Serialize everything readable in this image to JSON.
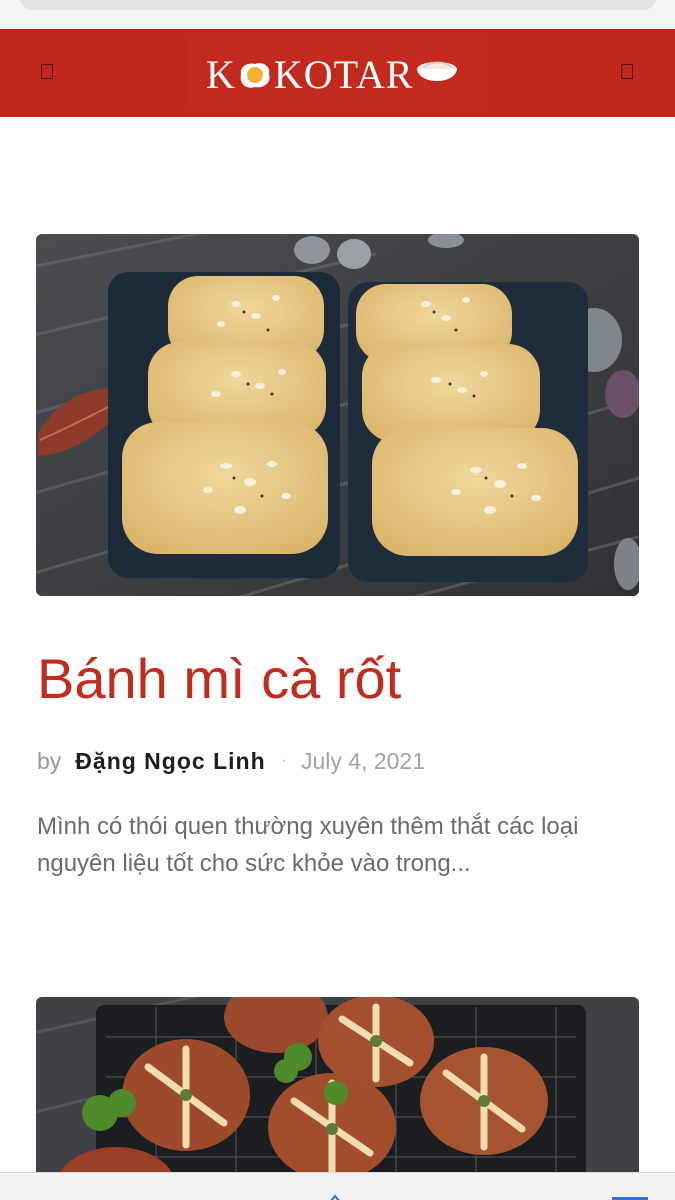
{
  "header": {
    "logo_text_left": "K",
    "logo_text_right": "KOTAR",
    "brand_color": "#c0281c",
    "menu_icon": "menu-icon",
    "search_icon": "search-icon"
  },
  "posts": [
    {
      "image": "oat-topped-carrot-bread-loaves-photo",
      "title": "Bánh mì cà rốt",
      "by_label": "by",
      "author": "Đặng Ngọc Linh",
      "separator": "·",
      "date": "July 4, 2021",
      "excerpt": "Mình có thói quen thường xuyên thêm thắt các loại nguyên liệu tốt cho sức khỏe vào trong..."
    },
    {
      "image": "garlic-cream-cheese-buns-photo"
    }
  ],
  "colors": {
    "title": "#c12c1f",
    "excerpt": "#6b6b6b",
    "meta": "#a3a3a3"
  }
}
